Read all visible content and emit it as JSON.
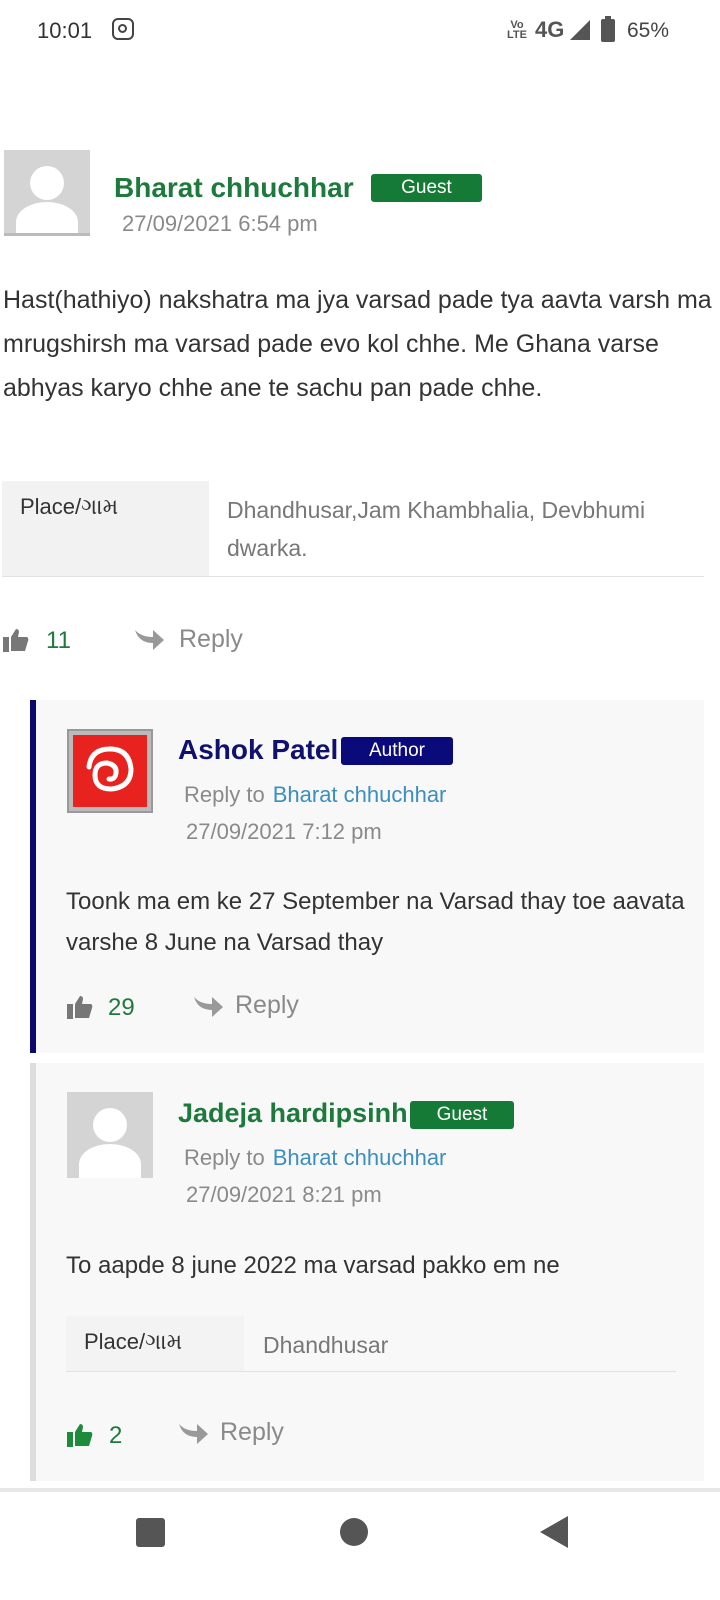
{
  "status_bar": {
    "time": "10:01",
    "network_type": "4G",
    "volte": "Vo LTE",
    "battery": "65%"
  },
  "comments": [
    {
      "author": "Bharat chhuchhar",
      "badge": "Guest",
      "date": "27/09/2021 6:54 pm",
      "text": "Hast(hathiyo) nakshatra ma jya varsad pade tya aavta varsh ma mrugshirsh ma varsad pade evo kol chhe. Me Ghana varse abhyas karyo chhe ane te sachu pan pade chhe.",
      "place_label": "Place/ગામ",
      "place_value": "Dhandhusar,Jam Khambhalia, Devbhumi dwarka.",
      "likes": "11",
      "reply_label": "Reply"
    },
    {
      "author": "Ashok Patel",
      "badge": "Author",
      "reply_to_label": "Reply to",
      "reply_to_name": "Bharat chhuchhar",
      "date": "27/09/2021 7:12 pm",
      "text": "Toonk ma em ke 27 September na Varsad thay toe aavata varshe 8 June na Varsad thay",
      "likes": "29",
      "reply_label": "Reply"
    },
    {
      "author": "Jadeja hardipsinh",
      "badge": "Guest",
      "reply_to_label": "Reply to",
      "reply_to_name": "Bharat chhuchhar",
      "date": "27/09/2021 8:21 pm",
      "text": "To aapde 8 june 2022 ma varsad pakko em ne",
      "place_label": "Place/ગામ",
      "place_value": "Dhandhusar",
      "likes": "2",
      "reply_label": "Reply"
    }
  ],
  "colors": {
    "guest_badge": "#167a37",
    "author_badge": "#0a0a7a",
    "author_bar": "#0a0a6e",
    "guest_bar": "#dddddd",
    "link": "#3c8ec0",
    "likes": "#1e7a3c"
  },
  "icons": [
    "instagram-icon",
    "signal-icon",
    "battery-icon",
    "avatar-placeholder-icon",
    "thumbs-up-icon",
    "reply-arrow-icon",
    "recents-icon",
    "home-icon",
    "back-icon"
  ]
}
